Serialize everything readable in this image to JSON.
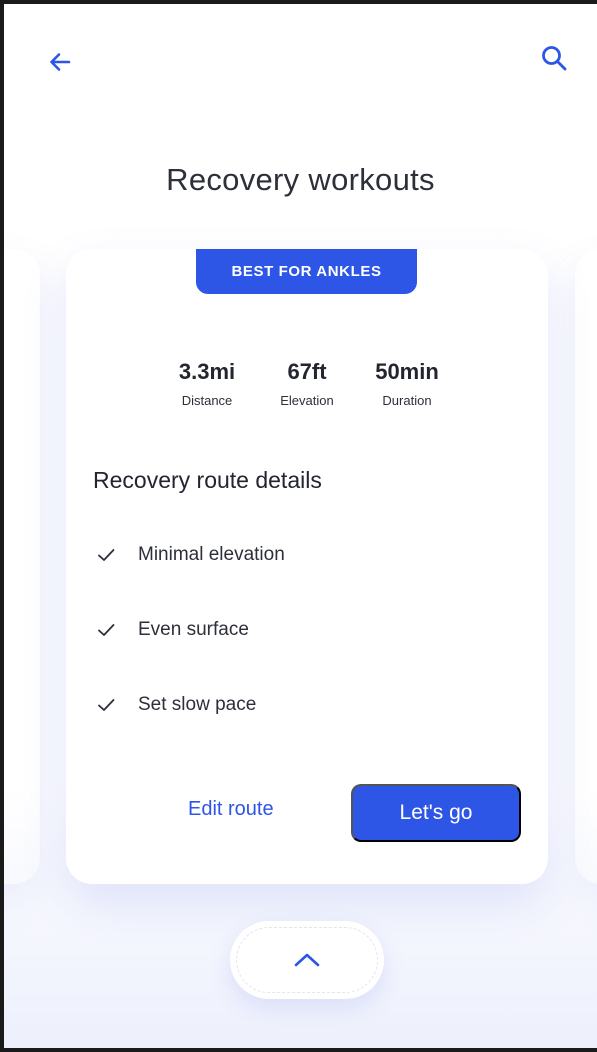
{
  "header": {
    "back_icon": "arrow-left-icon",
    "search_icon": "search-icon",
    "title": "Recovery workouts"
  },
  "card": {
    "tag": "BEST FOR ANKLES",
    "stats": [
      {
        "value": "3.3mi",
        "label": "Distance"
      },
      {
        "value": "67ft",
        "label": "Elevation"
      },
      {
        "value": "50min",
        "label": "Duration"
      }
    ],
    "details_title": "Recovery route details",
    "details": [
      {
        "icon": "check-icon",
        "label": "Minimal elevation"
      },
      {
        "icon": "check-icon",
        "label": "Even surface"
      },
      {
        "icon": "check-icon",
        "label": "Set slow pace"
      }
    ],
    "edit_label": "Edit route",
    "go_label": "Let's go"
  },
  "footer": {
    "expand_icon": "chevron-up-icon"
  },
  "colors": {
    "accent": "#2d55e6",
    "text": "#2d2f3a",
    "background": "#ffffff"
  }
}
